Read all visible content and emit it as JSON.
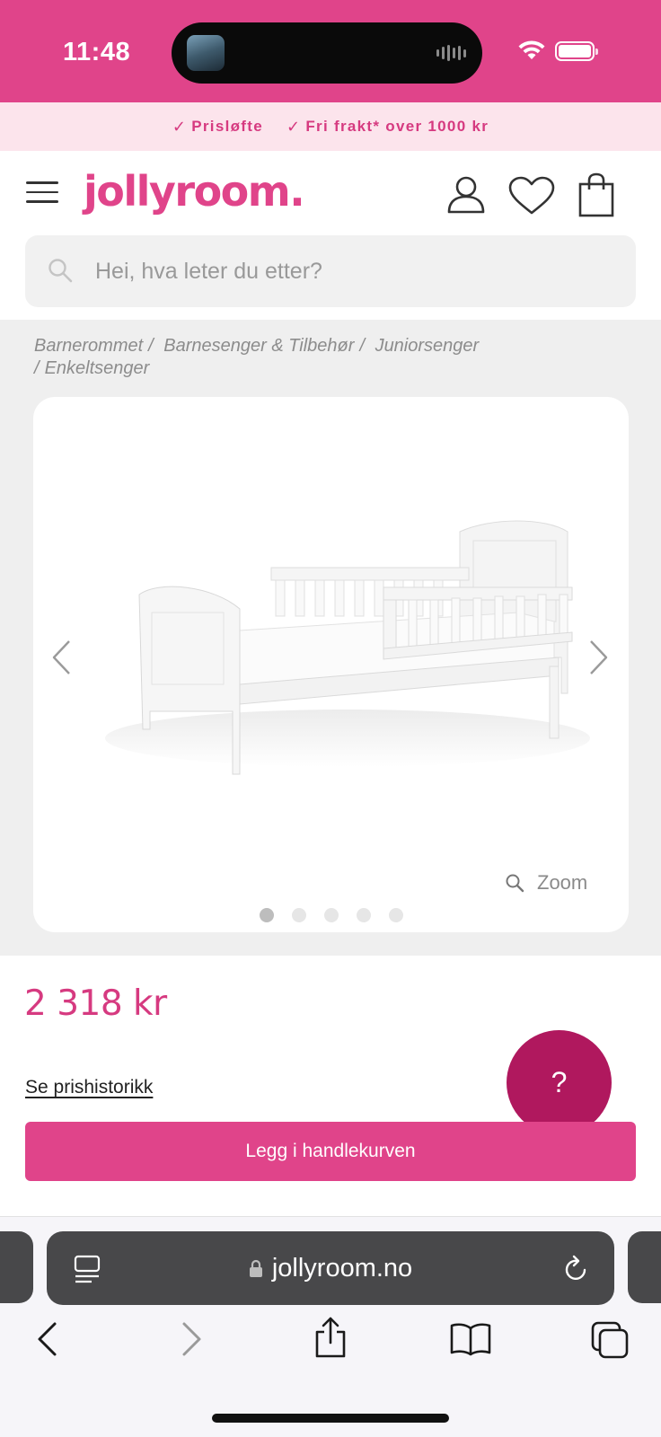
{
  "status_bar": {
    "time": "11:48",
    "icons": [
      "now-playing-artwork",
      "audio-waveform-icon",
      "wifi-icon",
      "battery-icon"
    ]
  },
  "promo": {
    "items": [
      {
        "label": "Prisløfte",
        "icon": "check-icon"
      },
      {
        "label": "Fri frakt* over 1000 kr",
        "icon": "check-icon"
      }
    ],
    "color": "#d63a80",
    "background": "#fce4ec"
  },
  "header": {
    "logo": "jollyroom.",
    "icons": [
      "menu-icon",
      "account-icon",
      "heart-icon",
      "shopping-bag-icon"
    ],
    "brand_color": "#e0448a"
  },
  "search": {
    "placeholder": "Hei, hva leter du etter?"
  },
  "breadcrumbs": [
    "Barnerommet",
    "Barnesenger & Tilbehør",
    "Juniorsenger",
    "Enkeltsenger"
  ],
  "gallery": {
    "image": "white-junior-bed-with-guard-rail",
    "zoom_label": "Zoom",
    "total_slides": 5,
    "active_slide": 1
  },
  "product": {
    "price": "2 318 kr",
    "price_history_link": "Se prishistorikk",
    "help_button": "?",
    "add_to_cart": "Legg i handlekurven"
  },
  "browser": {
    "url": "jollyroom.no",
    "toolbar_icons": [
      "back-icon",
      "forward-icon",
      "share-icon",
      "bookmarks-icon",
      "tabs-icon"
    ]
  }
}
